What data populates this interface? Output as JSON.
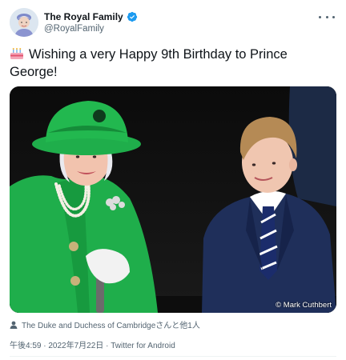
{
  "account": {
    "display_name": "The Royal Family",
    "handle": "@RoyalFamily"
  },
  "tweet": {
    "emoji": "🎂",
    "text": "Wishing a very Happy 9th Birthday to Prince George!"
  },
  "media": {
    "credit": "© Mark Cuthbert",
    "description_icon": "photo"
  },
  "tagged": {
    "text": "The Duke and Duchess of Cambridgeさんと他1人"
  },
  "meta": {
    "time": "午後4:59",
    "separator": " · ",
    "date": "2022年7月22日",
    "source": "Twitter for Android"
  },
  "colors": {
    "verified_blue": "#1d9bf0",
    "text_primary": "#0f1419",
    "text_secondary": "#536471",
    "queen_coat_green": "#1fae4b"
  },
  "icons": [
    "verified-badge-icon",
    "more-options-icon",
    "birthday-cake-icon",
    "person-tag-icon"
  ]
}
